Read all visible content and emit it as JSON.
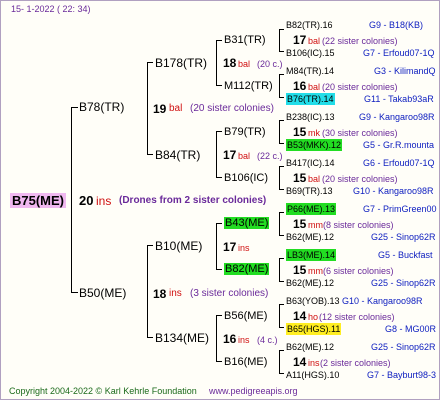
{
  "header": {
    "date": "15-   1-2022 ( 22: 34)"
  },
  "root": {
    "name": "B75(ME)",
    "count": "20",
    "abbr": "ins",
    "note": "(Drones from 2 sister colonies)"
  },
  "gen1": {
    "upper": {
      "name": "B78(TR)",
      "count": "19",
      "abbr": "bal",
      "note": "(20 sister colonies)"
    },
    "lower": {
      "name": "B50(ME)",
      "count": "18",
      "abbr": "ins",
      "note": "(3 sister colonies)"
    }
  },
  "gen2": {
    "g1": {
      "name": "B178(TR)",
      "count": "18",
      "abbr": "bal",
      "note": "(20 c.)"
    },
    "g2": {
      "name": "B84(TR)",
      "count": "17",
      "abbr": "bal",
      "note": "(22 c.)"
    },
    "g3": {
      "name": "B10(ME)",
      "count": "17",
      "abbr": "ins"
    },
    "g4": {
      "name": "B134(ME)",
      "count": "16",
      "abbr": "ins",
      "note": "(4 c.)"
    }
  },
  "gen3": {
    "a": {
      "name": "B31(TR)"
    },
    "b": {
      "name": "M112(TR)"
    },
    "c": {
      "name": "B79(TR)"
    },
    "d": {
      "name": "B106(IC)"
    },
    "e": {
      "name": "B43(ME)"
    },
    "f": {
      "name": "B82(ME)"
    },
    "g": {
      "name": "B56(ME)"
    },
    "h": {
      "name": "B16(ME)"
    }
  },
  "gen4": [
    {
      "top": {
        "name": "B82(TR).16",
        "code": "G9 - B18(KB)"
      },
      "count": "17",
      "abbr": "bal",
      "note": "(22 sister colonies)",
      "bot": {
        "name": "B106(IC).15",
        "code": "G7 - Erfoud07-1Q"
      }
    },
    {
      "top": {
        "name": "M84(TR).14",
        "code": "G3 - KilimandQ"
      },
      "count": "16",
      "abbr": "bal",
      "note": "(20 sister colonies)",
      "bot": {
        "name": "B76(TR).14",
        "code": "G11 - Takab93aR"
      }
    },
    {
      "top": {
        "name": "B238(IC).13",
        "code": "G9 - Kangaroo98R"
      },
      "count": "15",
      "abbr": "mk",
      "note": "(30 sister colonies)",
      "bot": {
        "name": "B53(MKK).12",
        "code": "G5 - Gr.R.mounta"
      }
    },
    {
      "top": {
        "name": "B417(IC).14",
        "code": "G6 - Erfoud07-1Q"
      },
      "count": "15",
      "abbr": "bal",
      "note": "(20 sister colonies)",
      "bot": {
        "name": "B69(TR).13",
        "code": "G10 - Kangaroo98R"
      }
    },
    {
      "top": {
        "name": "P66(ME).13",
        "code": "G7 - PrimGreen00"
      },
      "count": "15",
      "abbr": "mm",
      "note": "(8 sister colonies)",
      "bot": {
        "name": "B62(ME).12",
        "code": "G25 - Sinop62R"
      }
    },
    {
      "top": {
        "name": "LB3(ME).14",
        "code": "G5 - Buckfast"
      },
      "count": "15",
      "abbr": "mm",
      "note": "(6 sister colonies)",
      "bot": {
        "name": "B62(ME).12",
        "code": "G25 - Sinop62R"
      }
    },
    {
      "top": {
        "name": "B63(YOB).13",
        "code": "G10 - Kangaroo98R"
      },
      "count": "14",
      "abbr": "ho",
      "note": "(12 sister colonies)",
      "bot": {
        "name": "B65(HGS).11",
        "code": "G8 - MG00R"
      }
    },
    {
      "top": {
        "name": "B62(ME).12",
        "code": "G25 - Sinop62R"
      },
      "count": "14",
      "abbr": "ins",
      "note": "(2 sister colonies)",
      "bot": {
        "name": "A11(HGS).10",
        "code": "G7 - Bayburt98-3"
      }
    }
  ],
  "footer": {
    "copyright": "Copyright 2004-2022 © Karl Kehrle Foundation",
    "url": "www.pedigreeapis.org"
  }
}
